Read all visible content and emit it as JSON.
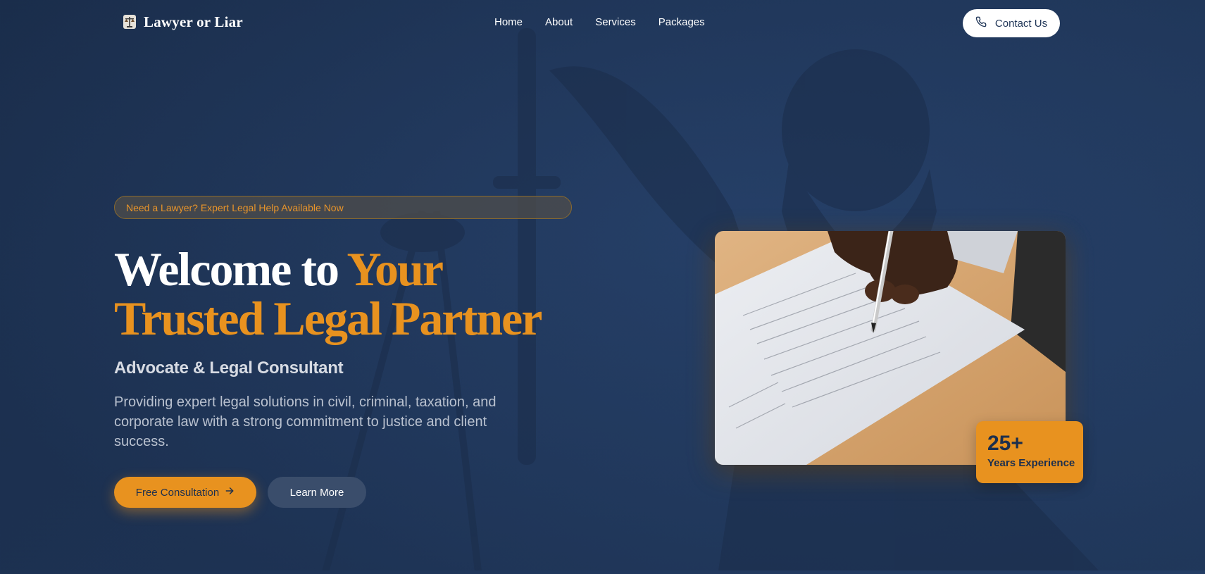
{
  "brand": {
    "name": "Lawyer or Liar",
    "logo_icon": "scales-of-justice-icon"
  },
  "nav": {
    "items": [
      {
        "label": "Home"
      },
      {
        "label": "About"
      },
      {
        "label": "Services"
      },
      {
        "label": "Packages"
      }
    ],
    "contact_label": "Contact Us",
    "contact_icon": "phone-icon"
  },
  "hero": {
    "badge": "Need a Lawyer? Expert Legal Help Available Now",
    "headline_white": "Welcome to ",
    "headline_gold_1": "Your",
    "headline_gold_2": "Trusted Legal Partner",
    "subtitle": "Advocate & Legal Consultant",
    "description": "Providing expert legal solutions in civil, criminal, taxation, and corporate law with a strong commitment to justice and client success.",
    "primary_cta": "Free Consultation",
    "primary_cta_icon": "arrow-right-icon",
    "secondary_cta": "Learn More"
  },
  "stat": {
    "value": "25+",
    "label": "Years Experience"
  },
  "colors": {
    "accent": "#e8921f",
    "navy": "#1f3557",
    "background": "#223a60"
  }
}
